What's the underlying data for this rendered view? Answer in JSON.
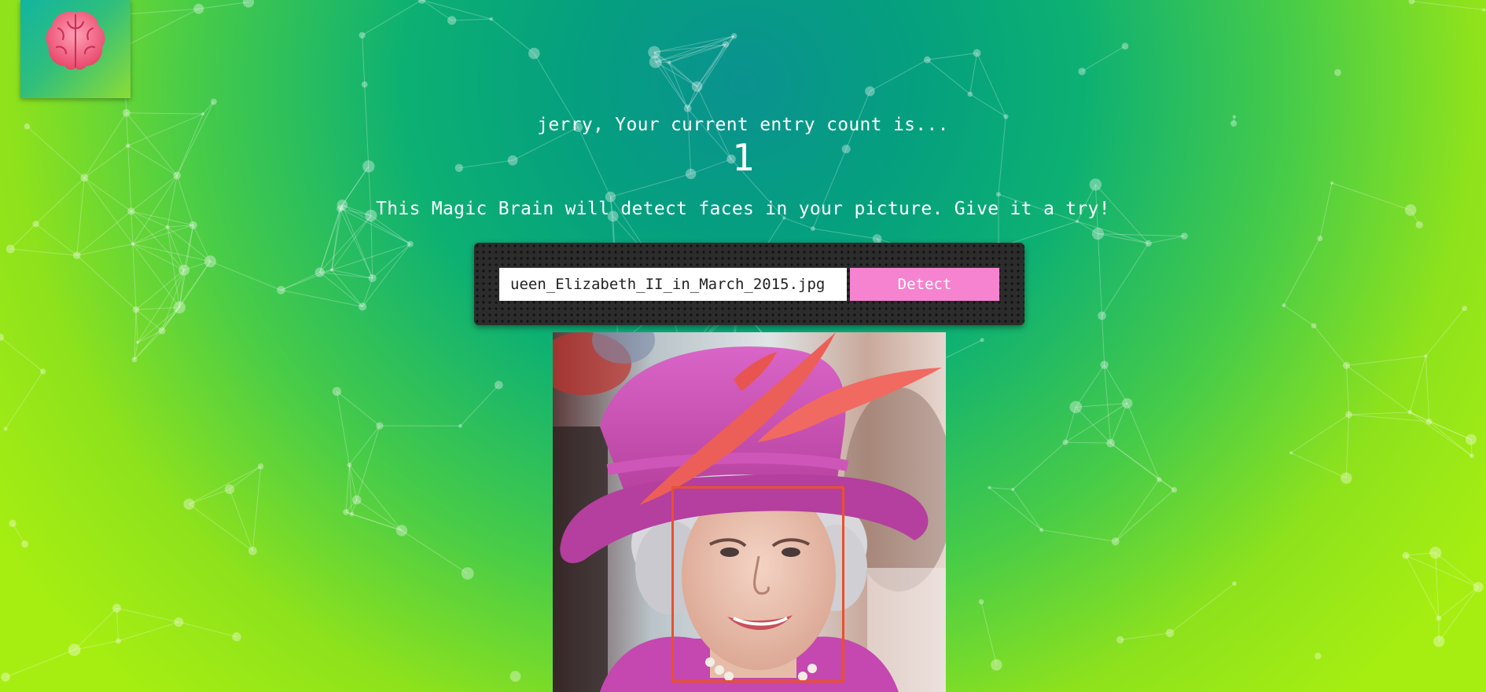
{
  "app": {
    "logo_icon": "brain-icon",
    "background_colors": [
      "#0a9290",
      "#0db073",
      "#8ee21c"
    ]
  },
  "rank": {
    "user_name": "jerry",
    "message": "jerry, Your current entry count is...",
    "count": "1"
  },
  "intro": {
    "text": "This Magic Brain will detect faces in your picture. Give it a try!"
  },
  "form": {
    "image_url": "ueen_Elizabeth_II_in_March_2015.jpg",
    "detect_label": "Detect",
    "button_color": "#f683cf"
  },
  "result": {
    "image_icon": "portrait-photo",
    "face_box_color": "#e8512c",
    "faces_detected": 1
  }
}
